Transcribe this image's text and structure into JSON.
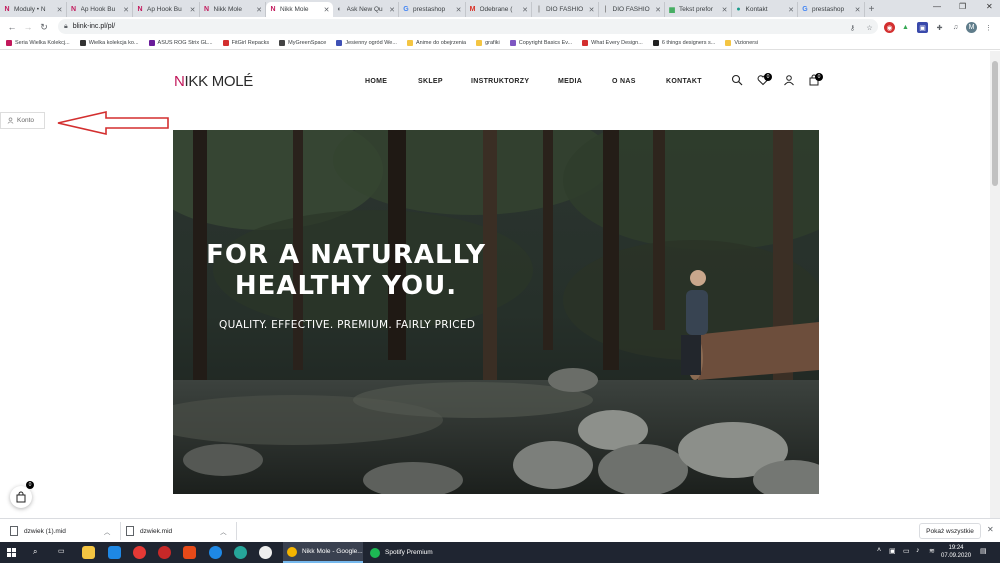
{
  "browser": {
    "tabs": [
      {
        "title": "Moduły • N",
        "fav": "N",
        "favcolor": "#c2185b"
      },
      {
        "title": "Ap Hook Bu",
        "fav": "N",
        "favcolor": "#c2185b"
      },
      {
        "title": "Ap Hook Bu",
        "fav": "N",
        "favcolor": "#c2185b"
      },
      {
        "title": "Nikk Mole",
        "fav": "N",
        "favcolor": "#c2185b"
      },
      {
        "title": "Nikk Mole",
        "fav": "N",
        "favcolor": "#c2185b"
      },
      {
        "title": "Ask New Qu",
        "fav": "◐",
        "favcolor": "#5f6368"
      },
      {
        "title": "prestashop",
        "fav": "G",
        "favcolor": "#4285f4"
      },
      {
        "title": "Odebrane (",
        "fav": "M",
        "favcolor": "#d93025"
      },
      {
        "title": "DIO FASHIO",
        "fav": "|",
        "favcolor": "#888"
      },
      {
        "title": "DIO FASHIO",
        "fav": "|",
        "favcolor": "#888"
      },
      {
        "title": "Tekst prefor",
        "fav": "▦",
        "favcolor": "#34a853"
      },
      {
        "title": "Kontakt",
        "fav": "●",
        "favcolor": "#1a9b8c"
      },
      {
        "title": "prestashop",
        "fav": "G",
        "favcolor": "#4285f4"
      }
    ],
    "new_tab": "+",
    "url": "blink-inc.pl/pl/",
    "bookmarks": [
      {
        "label": "Seria Wielka Kolekcj...",
        "color": "#c2185b"
      },
      {
        "label": "Wielka kolekcja ko...",
        "color": "#333"
      },
      {
        "label": "ASUS ROG Strix GL...",
        "color": "#6a1b9a"
      },
      {
        "label": "FitGirl Repacks",
        "color": "#d32f2f"
      },
      {
        "label": "MyGreenSpace",
        "color": "#444"
      },
      {
        "label": "Jesienny ogród We...",
        "color": "#3f51b5"
      },
      {
        "label": "Anime do obejrzenia",
        "color": "#f4c542"
      },
      {
        "label": "grafiki",
        "color": "#f4c542"
      },
      {
        "label": "Copyright Basics Ev...",
        "color": "#7e57c2"
      },
      {
        "label": "What Every Design...",
        "color": "#d32f2f"
      },
      {
        "label": "6 things designers s...",
        "color": "#222"
      },
      {
        "label": "Vizionersi",
        "color": "#f4c542"
      }
    ]
  },
  "site": {
    "logo": "NIKK MOLÉ",
    "logo_first": "N",
    "logo_rest": "IKK MOLÉ",
    "menu": [
      "HOME",
      "SKLEP",
      "INSTRUKTORZY",
      "MEDIA",
      "O NAS",
      "KONTAKT"
    ],
    "wishlist_count": "0",
    "cart_count": "0",
    "konto_label": "Konto",
    "hero": {
      "line1": "FOR A NATURALLY",
      "line2": "HEALTHY YOU.",
      "subtitle": "QUALITY. EFFECTIVE. PREMIUM. FAIRLY PRICED"
    },
    "float_cart_count": "0"
  },
  "downloads": {
    "items": [
      "dzwiek (1).mid",
      "dzwiek.mid"
    ],
    "show_all": "Pokaż wszystkie"
  },
  "taskbar": {
    "apps": [
      {
        "label": "Nikk Mole - Google...",
        "color": "#f4b400"
      },
      {
        "label": "Spotify Premium",
        "color": "#1db954"
      }
    ],
    "time": "19:24",
    "date": "07.09.2020"
  }
}
